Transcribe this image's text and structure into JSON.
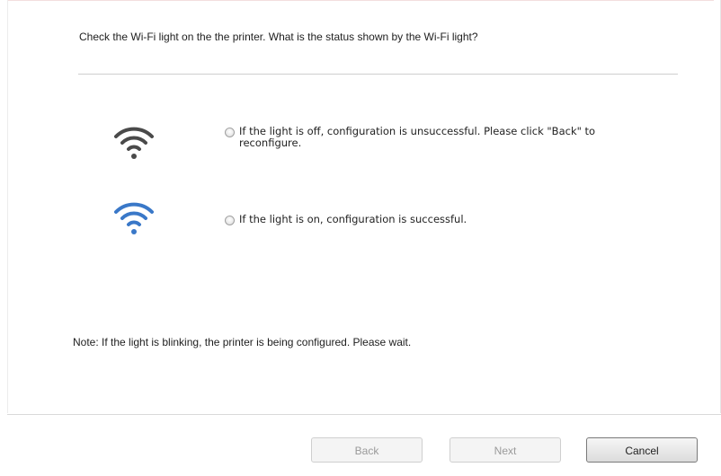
{
  "question": "Check the Wi-Fi light on the the printer. What is the status shown by the Wi-Fi light?",
  "options": [
    {
      "label": "If the light is off, configuration is unsuccessful. Please click \"Back\" to reconfigure.",
      "icon": "wifi-icon-off",
      "icon_color": "#4a4a4a"
    },
    {
      "label": "If the light is on, configuration is successful.",
      "icon": "wifi-icon-on",
      "icon_color": "#3a78c8"
    }
  ],
  "note": "Note:  If the light is blinking, the printer is being configured.  Please wait.",
  "buttons": {
    "back": "Back",
    "next": "Next",
    "cancel": "Cancel"
  }
}
